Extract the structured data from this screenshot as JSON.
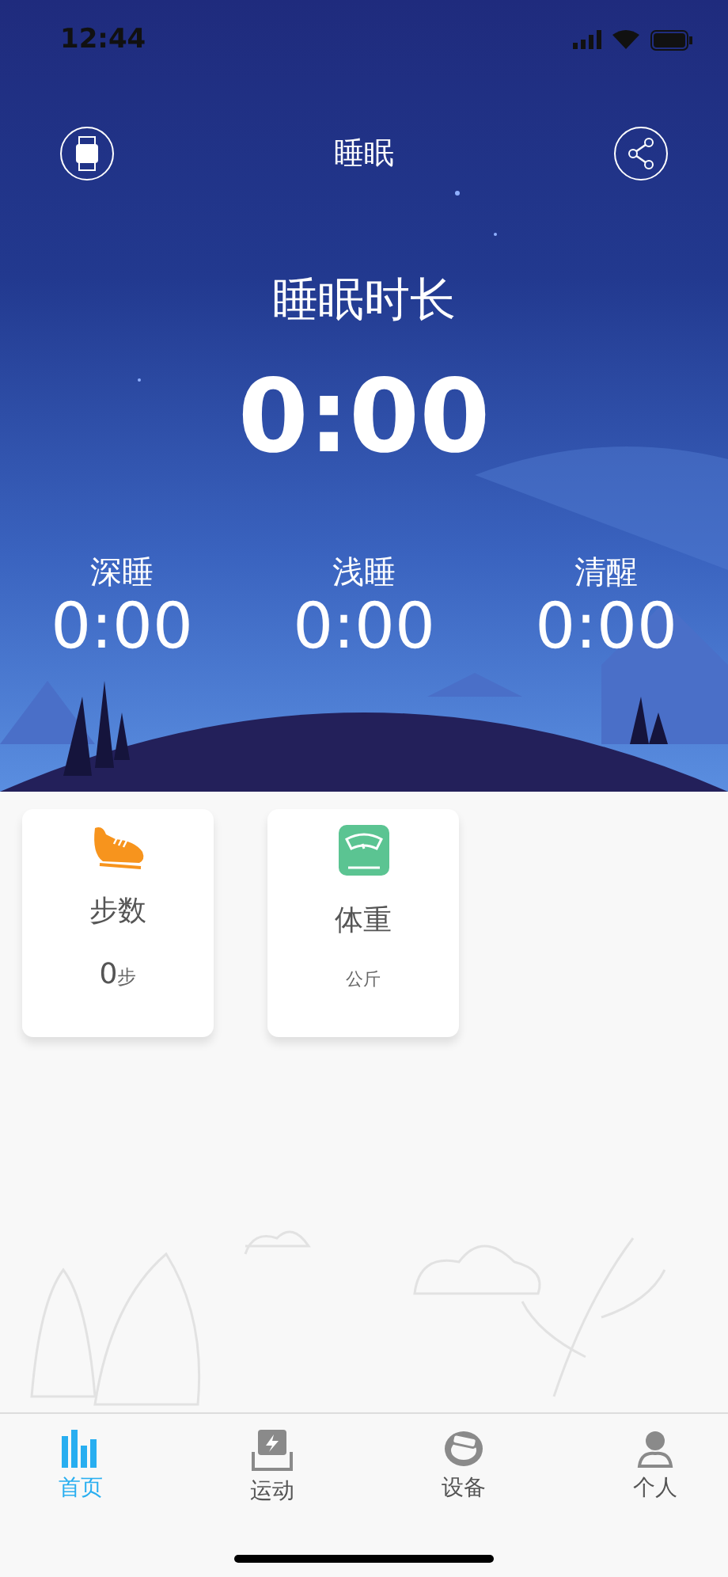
{
  "status_bar": {
    "time": "12:44"
  },
  "header": {
    "title": "睡眠"
  },
  "sleep": {
    "label": "睡眠时长",
    "total": "0:00",
    "stages": [
      {
        "label": "深睡",
        "value": "0:00"
      },
      {
        "label": "浅睡",
        "value": "0:00"
      },
      {
        "label": "清醒",
        "value": "0:00"
      }
    ]
  },
  "cards": [
    {
      "kind": "steps",
      "title": "步数",
      "value": "0",
      "unit": "步"
    },
    {
      "kind": "weight",
      "title": "体重",
      "unit": "公斤"
    }
  ],
  "tabs": [
    {
      "kind": "home",
      "label": "首页",
      "selected": true
    },
    {
      "kind": "sport",
      "label": "运动",
      "selected": false
    },
    {
      "kind": "device",
      "label": "设备",
      "selected": false
    },
    {
      "kind": "profile",
      "label": "个人",
      "selected": false
    }
  ]
}
